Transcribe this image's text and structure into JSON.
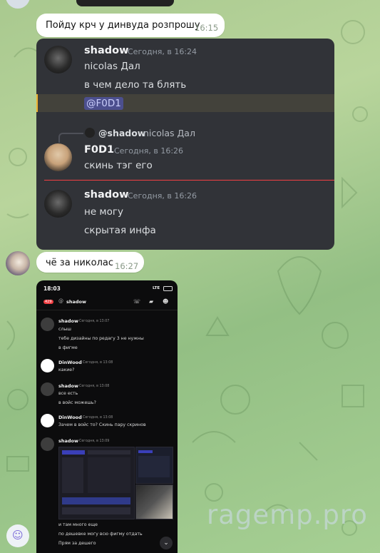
{
  "chat": {
    "message1": {
      "text": "Пойду крч у динвуда розпрошу",
      "time": "16:15"
    },
    "message2": {
      "text": "чё за николас",
      "time": "16:27"
    }
  },
  "discord": {
    "msg1": {
      "author": "shadow",
      "stamp": "Сегодня, в 16:24",
      "lines": [
        "nicolas Дал",
        "в чем дело та блять"
      ],
      "mention": "@F0D1"
    },
    "reply": {
      "ref_author": "@shadow",
      "ref_text": "nicolas Дал",
      "author": "F0D1",
      "stamp": "Сегодня, в 16:26",
      "text": "скинь тэг его"
    },
    "msg2": {
      "author": "shadow",
      "stamp": "Сегодня, в 16:26",
      "lines": [
        "не могу",
        "скрытая инфа"
      ]
    }
  },
  "phone": {
    "status_time": "18:03",
    "status_net": "LTE",
    "badge": "429",
    "channel": "shadow",
    "messages": [
      {
        "author": "shadow",
        "stamp": "Сегодня, в 13:07",
        "lines": [
          "слыш",
          "тебе дизайны по редагу 3 не нужны",
          "в фигме"
        ]
      },
      {
        "author": "DinWood",
        "stamp": "Сегодня, в 13:08",
        "lines": [
          "какие?"
        ]
      },
      {
        "author": "shadow",
        "stamp": "Сегодня, в 13:08",
        "lines": [
          "все есть",
          "в войс можешь?"
        ]
      },
      {
        "author": "DinWood",
        "stamp": "Сегодня, в 13:08",
        "lines": [
          "Зачем в войс то? Скинь пару скринов"
        ]
      },
      {
        "author": "shadow",
        "stamp": "Сегодня, в 13:09",
        "lines": []
      }
    ],
    "after_lines": [
      "и там много еще",
      "по дешевке могу всю фигму отдать",
      "Прям за дешего"
    ]
  },
  "watermark": "ragemp.pro",
  "colors": {
    "accent_red": "#f23f43",
    "mention_bg": "#4c4f8e",
    "discord_bg": "#313338"
  }
}
